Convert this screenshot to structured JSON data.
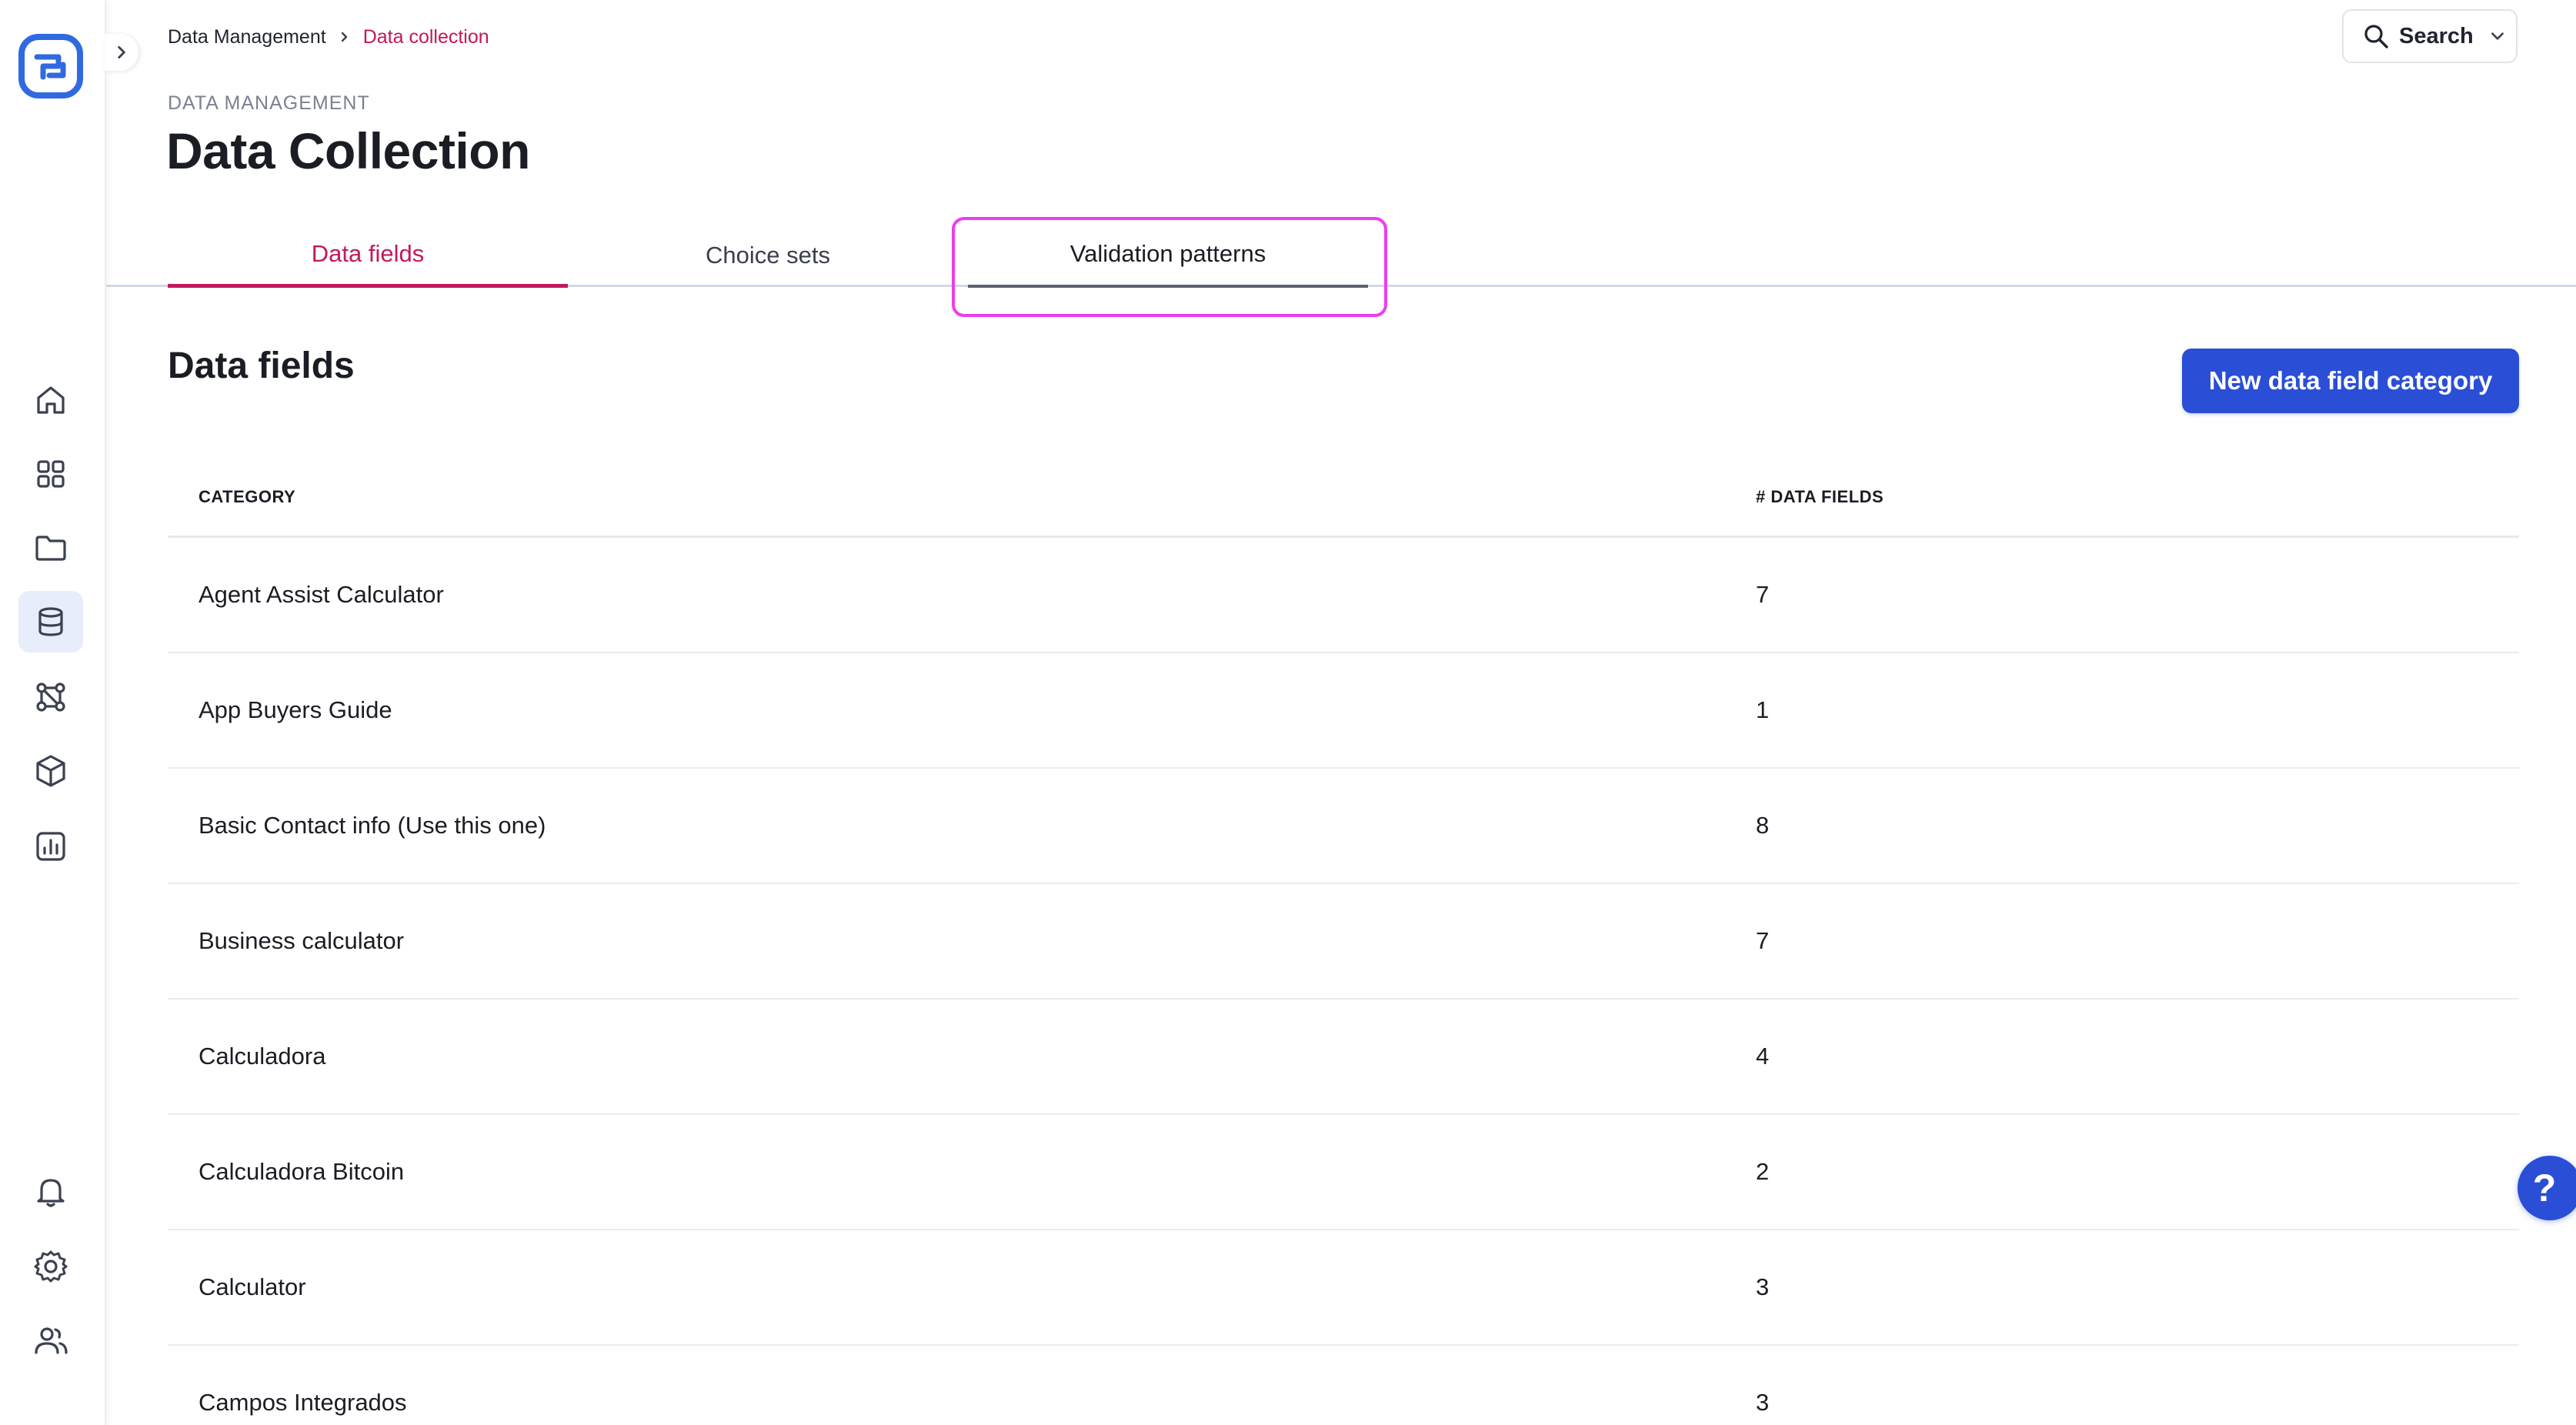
{
  "breadcrumb": {
    "parent": "Data Management",
    "current": "Data collection"
  },
  "search": {
    "label": "Search"
  },
  "header": {
    "eyebrow": "DATA MANAGEMENT",
    "title": "Data Collection"
  },
  "tabs": [
    {
      "label": "Data fields",
      "state": "active"
    },
    {
      "label": "Choice sets",
      "state": "default"
    },
    {
      "label": "Validation patterns",
      "state": "focused"
    }
  ],
  "section": {
    "title": "Data fields",
    "new_button_label": "New data field category"
  },
  "table": {
    "columns": [
      "CATEGORY",
      "# DATA FIELDS"
    ],
    "rows": [
      {
        "category": "Agent Assist Calculator",
        "count": "7"
      },
      {
        "category": "App Buyers Guide",
        "count": "1"
      },
      {
        "category": "Basic Contact info (Use this one)",
        "count": "8"
      },
      {
        "category": "Business calculator",
        "count": "7"
      },
      {
        "category": "Calculadora",
        "count": "4"
      },
      {
        "category": "Calculadora Bitcoin",
        "count": "2"
      },
      {
        "category": "Calculator",
        "count": "3"
      },
      {
        "category": "Campos Integrados",
        "count": "3"
      }
    ]
  },
  "help": {
    "label": "?"
  },
  "sidebar": {
    "top_items": [
      "home-icon",
      "grid-icon",
      "folder-icon",
      "database-icon",
      "workflow-icon",
      "cube-icon",
      "chart-icon"
    ],
    "bottom_items": [
      "bell-icon",
      "gear-icon",
      "users-icon"
    ],
    "active": "database-icon"
  },
  "colors": {
    "accent_pink": "#c2185b",
    "primary_blue": "#2a4ed6",
    "highlight_magenta": "#ee3cf0"
  }
}
